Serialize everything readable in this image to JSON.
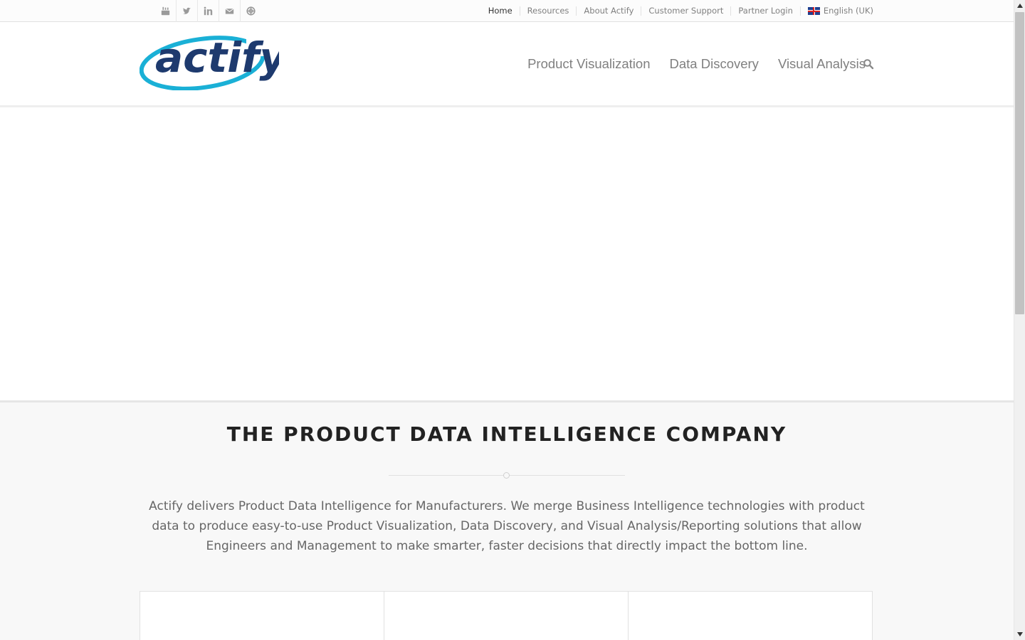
{
  "topbar": {
    "social_icons": [
      "youtube-icon",
      "twitter-icon",
      "linkedin-icon",
      "mail-icon",
      "support-icon"
    ],
    "links": [
      {
        "label": "Home",
        "active": true
      },
      {
        "label": "Resources",
        "active": false
      },
      {
        "label": "About Actify",
        "active": false
      },
      {
        "label": "Customer Support",
        "active": false
      },
      {
        "label": "Partner Login",
        "active": false
      }
    ],
    "language": "English (UK)"
  },
  "header": {
    "logo_text": "actify",
    "nav": [
      "Product Visualization",
      "Data Discovery",
      "Visual Analysis"
    ],
    "search_icon": "search-icon"
  },
  "main": {
    "headline": "THE PRODUCT DATA INTELLIGENCE COMPANY",
    "intro": "Actify delivers Product Data Intelligence for Manufacturers. We merge Business Intelligence technologies with product data to produce easy-to-use Product Visualization, Data Discovery, and Visual Analysis/Reporting solutions that allow Engineers and Management to make smarter, faster decisions that directly impact the bottom line."
  },
  "colors": {
    "logo_navy": "#1e3a6e",
    "logo_cyan": "#1ab0d6",
    "headline": "#222222",
    "body_text": "#666666"
  }
}
